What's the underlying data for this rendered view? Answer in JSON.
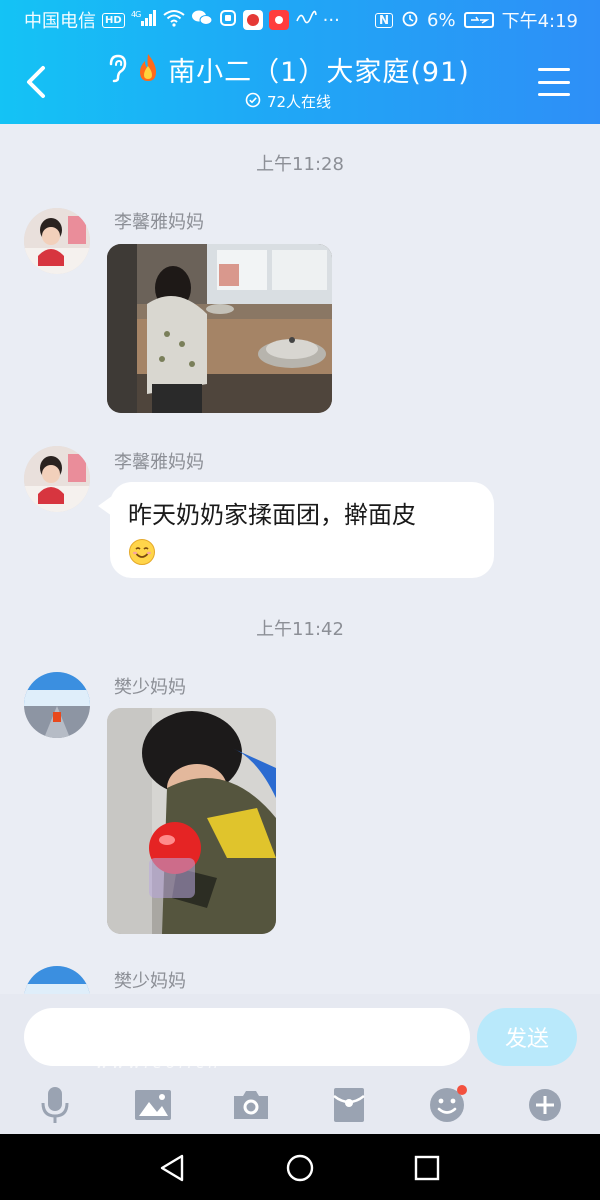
{
  "status_bar": {
    "carrier": "中国电信",
    "hd": "HD",
    "network": "4G",
    "nfc": "N",
    "battery_pct": "6%",
    "time": "下午4:19",
    "overflow": "···"
  },
  "header": {
    "title": "南小二（1）大家庭(91)",
    "online": "72人在线"
  },
  "chat": {
    "messages": [
      {
        "timestamp": "上午11:28",
        "sender": "李馨雅妈妈",
        "type": "image"
      },
      {
        "sender": "李馨雅妈妈",
        "type": "text",
        "text": "昨天奶奶家揉面团，擀面皮"
      },
      {
        "timestamp": "上午11:42",
        "sender": "樊少妈妈",
        "type": "image"
      },
      {
        "sender": "樊少妈妈",
        "type": "image"
      }
    ]
  },
  "input": {
    "placeholder": "",
    "send_label": "发送",
    "watermark": "www.eol.cn"
  },
  "toolbar": {
    "items": [
      "mic-icon",
      "image-icon",
      "camera-icon",
      "red-packet-icon",
      "emoji-icon",
      "plus-icon"
    ]
  },
  "colors": {
    "header_start": "#14c3f5",
    "header_end": "#2e8ff7",
    "chat_bg": "#eaedf4",
    "send_button": "#b9e9fb",
    "badge": "#f3513f"
  }
}
